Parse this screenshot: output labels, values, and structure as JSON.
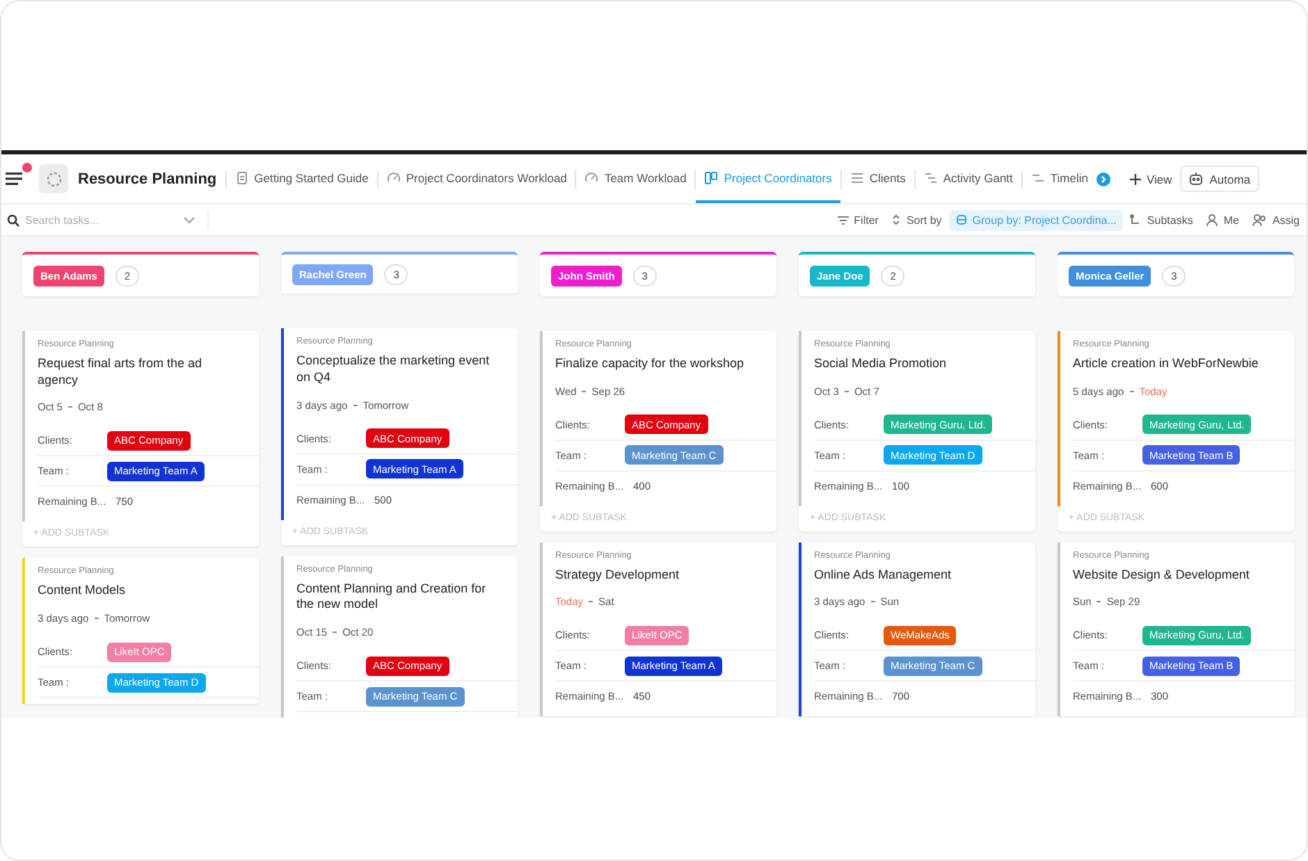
{
  "header": {
    "space": "Resource Planning",
    "tabs": [
      {
        "label": "Getting Started Guide",
        "selected": false
      },
      {
        "label": "Project Coordinators Workload",
        "selected": false
      },
      {
        "label": "Team Workload",
        "selected": false
      },
      {
        "label": "Project Coordinators",
        "selected": true
      },
      {
        "label": "Clients",
        "selected": false
      },
      {
        "label": "Activity Gantt",
        "selected": false
      },
      {
        "label": "Timelin",
        "selected": false
      }
    ],
    "add_view": "View",
    "automations": "Automa"
  },
  "toolbar": {
    "search": {
      "placeholder": "Search tasks..."
    },
    "filter": "Filter",
    "sort": "Sort by",
    "group": "Group by: Project Coordina...",
    "subtasks": "Subtasks",
    "me": "Me",
    "assignees": "Assig"
  },
  "columns": [
    {
      "name": "Ben Adams",
      "color": "#f0436e",
      "count": "2",
      "cards": [
        {
          "project": "Resource Planning",
          "title": "Request final arts from the ad agency",
          "start": "Oct 5",
          "start_due": false,
          "end": "Oct 8",
          "end_due": false,
          "color": "#c8c8c8",
          "clients_label": "Clients:",
          "client": {
            "label": "ABC Company",
            "color": "#e3000f"
          },
          "team_label": "Team :",
          "team": {
            "label": "Marketing Team A",
            "color": "#1033d6"
          },
          "remaining_label": "Remaining B...",
          "remaining": "750",
          "add_subtask": "+ ADD SUBTASK"
        },
        {
          "project": "Resource Planning",
          "title": "Content Models",
          "start": "3 days ago",
          "start_due": false,
          "end": "Tomorrow",
          "end_due": false,
          "color": "#f7d51a",
          "clients_label": "Clients:",
          "client": {
            "label": "LikeIt OPC",
            "color": "#f27ea5"
          },
          "team_label": "Team :",
          "team": {
            "label": "Marketing Team D",
            "color": "#0aa9ef"
          }
        }
      ]
    },
    {
      "name": "Rachel Green",
      "color": "#7ea8f6",
      "count": "3",
      "cards": [
        {
          "project": "Resource Planning",
          "title": "Conceptualize the marketing event on Q4",
          "start": "3 days ago",
          "start_due": false,
          "end": "Tomorrow",
          "end_due": false,
          "color": "#1d3fd8",
          "clients_label": "Clients:",
          "client": {
            "label": "ABC Company",
            "color": "#e3000f"
          },
          "team_label": "Team :",
          "team": {
            "label": "Marketing Team A",
            "color": "#1033d6"
          },
          "remaining_label": "Remaining B...",
          "remaining": "500",
          "add_subtask": "+ ADD SUBTASK"
        },
        {
          "project": "Resource Planning",
          "title": "Content Planning and Creation for the new model",
          "start": "Oct 15",
          "start_due": false,
          "end": "Oct 20",
          "end_due": false,
          "color": "#c8c8c8",
          "clients_label": "Clients:",
          "client": {
            "label": "ABC Company",
            "color": "#e3000f"
          },
          "team_label": "Team :",
          "team": {
            "label": "Marketing Team C",
            "color": "#5b92d0"
          }
        }
      ]
    },
    {
      "name": "John Smith",
      "color": "#ee1ecf",
      "count": "3",
      "cards": [
        {
          "project": "Resource Planning",
          "title": "Finalize capacity for the workshop",
          "start": "Wed",
          "start_due": false,
          "end": "Sep 26",
          "end_due": false,
          "color": "#c8c8c8",
          "clients_label": "Clients:",
          "client": {
            "label": "ABC Company",
            "color": "#e3000f"
          },
          "team_label": "Team :",
          "team": {
            "label": "Marketing Team C",
            "color": "#5b92d0"
          },
          "remaining_label": "Remaining B...",
          "remaining": "400",
          "add_subtask": "+ ADD SUBTASK"
        },
        {
          "project": "Resource Planning",
          "title": "Strategy Development",
          "start": "Today",
          "start_due": true,
          "end": "Sat",
          "end_due": false,
          "color": "#c8c8c8",
          "clients_label": "Clients:",
          "client": {
            "label": "LikeIt OPC",
            "color": "#f27ea5"
          },
          "team_label": "Team :",
          "team": {
            "label": "Marketing Team A",
            "color": "#1033d6"
          },
          "remaining_label": "Remaining B...",
          "remaining": "450"
        }
      ]
    },
    {
      "name": "Jane Doe",
      "color": "#13b9c9",
      "count": "2",
      "cards": [
        {
          "project": "Resource Planning",
          "title": "Social Media Promotion",
          "start": "Oct 3",
          "start_due": false,
          "end": "Oct 7",
          "end_due": false,
          "color": "#c8c8c8",
          "clients_label": "Clients:",
          "client": {
            "label": "Marketing Guru, Ltd.",
            "color": "#1fb78f"
          },
          "team_label": "Team :",
          "team": {
            "label": "Marketing Team D",
            "color": "#0aa9ef"
          },
          "remaining_label": "Remaining B...",
          "remaining": "100",
          "add_subtask": "+ ADD SUBTASK"
        },
        {
          "project": "Resource Planning",
          "title": "Online Ads Management",
          "start": "3 days ago",
          "start_due": false,
          "end": "Sun",
          "end_due": false,
          "color": "#1d3fd8",
          "clients_label": "Clients:",
          "client": {
            "label": "WeMakeAds",
            "color": "#e8580c"
          },
          "team_label": "Team :",
          "team": {
            "label": "Marketing Team C",
            "color": "#5b92d0"
          },
          "remaining_label": "Remaining B...",
          "remaining": "700"
        }
      ]
    },
    {
      "name": "Monica Geller",
      "color": "#3f8fdc",
      "count": "3",
      "cards": [
        {
          "project": "Resource Planning",
          "title": "Article creation in WebForNewbie",
          "start": "5 days ago",
          "start_due": false,
          "end": "Today",
          "end_due": true,
          "color": "#f7861e",
          "clients_label": "Clients:",
          "client": {
            "label": "Marketing Guru, Ltd.",
            "color": "#1fb78f"
          },
          "team_label": "Team :",
          "team": {
            "label": "Marketing Team B",
            "color": "#4660e3"
          },
          "remaining_label": "Remaining B...",
          "remaining": "600",
          "add_subtask": "+ ADD SUBTASK"
        },
        {
          "project": "Resource Planning",
          "title": "Website Design & Development",
          "start": "Sun",
          "start_due": false,
          "end": "Sep 29",
          "end_due": false,
          "color": "#c8c8c8",
          "clients_label": "Clients:",
          "client": {
            "label": "Marketing Guru, Ltd.",
            "color": "#1fb78f"
          },
          "team_label": "Team :",
          "team": {
            "label": "Marketing Team B",
            "color": "#4660e3"
          },
          "remaining_label": "Remaining B...",
          "remaining": "300"
        }
      ]
    }
  ]
}
